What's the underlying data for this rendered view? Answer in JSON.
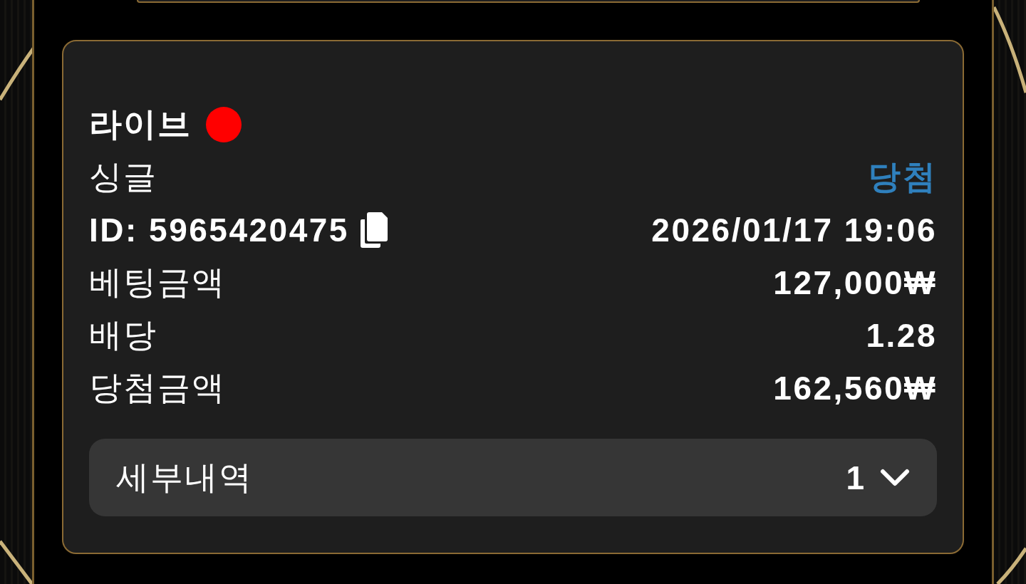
{
  "bet": {
    "mode": "라이브",
    "live": true,
    "type": "싱글",
    "status": {
      "kind": "win",
      "label": "당첨"
    },
    "id": "ID: 5965420475",
    "datetime": "2026/01/17 19:06",
    "rows": [
      {
        "label": "베팅금액",
        "value": "127,000₩"
      },
      {
        "label": "배당",
        "value": "1.28"
      },
      {
        "label": "당첨금액",
        "value": "162,560₩"
      }
    ],
    "details": {
      "label": "세부내역",
      "count": "1",
      "expanded": false
    }
  }
}
